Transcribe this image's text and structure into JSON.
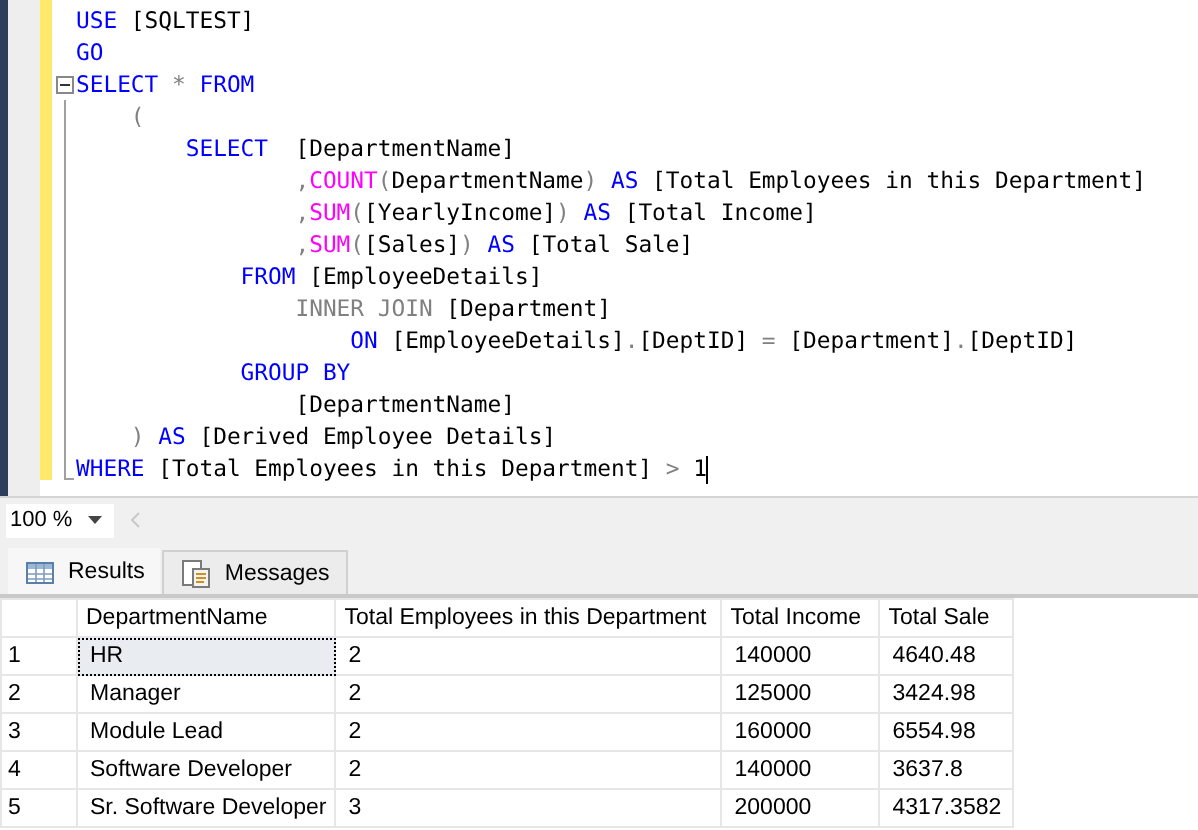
{
  "editor": {
    "lines": [
      {
        "kind": "none",
        "tokens": [
          {
            "kind": "keyword",
            "text": "USE"
          },
          {
            "kind": "text",
            "text": " [SQLTEST]"
          }
        ]
      },
      {
        "kind": "none",
        "tokens": [
          {
            "kind": "keyword",
            "text": "GO"
          }
        ]
      },
      {
        "kind": "open",
        "tokens": [
          {
            "kind": "keyword",
            "text": "SELECT"
          },
          {
            "kind": "operator",
            "text": " *"
          },
          {
            "kind": "keyword",
            "text": " FROM"
          }
        ]
      },
      {
        "kind": "inner",
        "tokens": [
          {
            "kind": "operator",
            "text": "    ("
          }
        ]
      },
      {
        "kind": "inner",
        "tokens": [
          {
            "kind": "keyword",
            "text": "        SELECT"
          },
          {
            "kind": "text",
            "text": "  [DepartmentName]"
          }
        ]
      },
      {
        "kind": "inner",
        "tokens": [
          {
            "kind": "operator",
            "text": "                ,"
          },
          {
            "kind": "function",
            "text": "COUNT"
          },
          {
            "kind": "operator",
            "text": "("
          },
          {
            "kind": "text",
            "text": "DepartmentName"
          },
          {
            "kind": "operator",
            "text": ")"
          },
          {
            "kind": "keyword",
            "text": " AS"
          },
          {
            "kind": "text",
            "text": " [Total Employees in this Department]"
          }
        ]
      },
      {
        "kind": "inner",
        "tokens": [
          {
            "kind": "operator",
            "text": "                ,"
          },
          {
            "kind": "function",
            "text": "SUM"
          },
          {
            "kind": "operator",
            "text": "("
          },
          {
            "kind": "text",
            "text": "[YearlyIncome]"
          },
          {
            "kind": "operator",
            "text": ")"
          },
          {
            "kind": "keyword",
            "text": " AS"
          },
          {
            "kind": "text",
            "text": " [Total Income]"
          }
        ]
      },
      {
        "kind": "inner",
        "tokens": [
          {
            "kind": "operator",
            "text": "                ,"
          },
          {
            "kind": "function",
            "text": "SUM"
          },
          {
            "kind": "operator",
            "text": "("
          },
          {
            "kind": "text",
            "text": "[Sales]"
          },
          {
            "kind": "operator",
            "text": ")"
          },
          {
            "kind": "keyword",
            "text": " AS"
          },
          {
            "kind": "text",
            "text": " [Total Sale]"
          }
        ]
      },
      {
        "kind": "inner",
        "tokens": [
          {
            "kind": "keyword",
            "text": "            FROM"
          },
          {
            "kind": "text",
            "text": " [EmployeeDetails]"
          }
        ]
      },
      {
        "kind": "inner",
        "tokens": [
          {
            "kind": "operator",
            "text": "                INNER JOIN"
          },
          {
            "kind": "text",
            "text": " [Department]"
          }
        ]
      },
      {
        "kind": "inner",
        "tokens": [
          {
            "kind": "keyword",
            "text": "                    ON"
          },
          {
            "kind": "text",
            "text": " [EmployeeDetails]"
          },
          {
            "kind": "operator",
            "text": "."
          },
          {
            "kind": "text",
            "text": "[DeptID] "
          },
          {
            "kind": "operator",
            "text": "="
          },
          {
            "kind": "text",
            "text": " [Department]"
          },
          {
            "kind": "operator",
            "text": "."
          },
          {
            "kind": "text",
            "text": "[DeptID]"
          }
        ]
      },
      {
        "kind": "inner",
        "tokens": [
          {
            "kind": "keyword",
            "text": "            GROUP BY"
          }
        ]
      },
      {
        "kind": "inner",
        "tokens": [
          {
            "kind": "text",
            "text": "                [DepartmentName]"
          }
        ]
      },
      {
        "kind": "inner",
        "tokens": [
          {
            "kind": "operator",
            "text": "    )"
          },
          {
            "kind": "keyword",
            "text": " AS"
          },
          {
            "kind": "text",
            "text": " [Derived Employee Details]"
          }
        ]
      },
      {
        "kind": "end",
        "caret": true,
        "tokens": [
          {
            "kind": "keyword",
            "text": "WHERE"
          },
          {
            "kind": "text",
            "text": " [Total Employees in this Department] "
          },
          {
            "kind": "operator",
            "text": ">"
          },
          {
            "kind": "text",
            "text": " 1"
          }
        ]
      }
    ]
  },
  "zoom": {
    "value": "100 %"
  },
  "tabs": [
    {
      "label": "Results",
      "kind": "grid",
      "selected": true
    },
    {
      "label": "Messages",
      "kind": "document",
      "selected": false
    }
  ],
  "grid": {
    "columns": [
      "DepartmentName",
      "Total Employees in this Department",
      "Total Income",
      "Total Sale"
    ],
    "rows": [
      {
        "number": "1",
        "cells": [
          {
            "text": "HR",
            "selected": true
          },
          {
            "text": "2",
            "selected": false
          },
          {
            "text": "140000",
            "selected": false
          },
          {
            "text": "4640.48",
            "selected": false
          }
        ]
      },
      {
        "number": "2",
        "cells": [
          {
            "text": "Manager",
            "selected": false
          },
          {
            "text": "2",
            "selected": false
          },
          {
            "text": "125000",
            "selected": false
          },
          {
            "text": "3424.98",
            "selected": false
          }
        ]
      },
      {
        "number": "3",
        "cells": [
          {
            "text": "Module Lead",
            "selected": false
          },
          {
            "text": "2",
            "selected": false
          },
          {
            "text": "160000",
            "selected": false
          },
          {
            "text": "6554.98",
            "selected": false
          }
        ]
      },
      {
        "number": "4",
        "cells": [
          {
            "text": "Software Developer",
            "selected": false
          },
          {
            "text": "2",
            "selected": false
          },
          {
            "text": "140000",
            "selected": false
          },
          {
            "text": "3637.8",
            "selected": false
          }
        ]
      },
      {
        "number": "5",
        "cells": [
          {
            "text": "Sr. Software Developer",
            "selected": false
          },
          {
            "text": "3",
            "selected": false
          },
          {
            "text": "200000",
            "selected": false
          },
          {
            "text": "4317.3582",
            "selected": false
          }
        ]
      }
    ]
  }
}
